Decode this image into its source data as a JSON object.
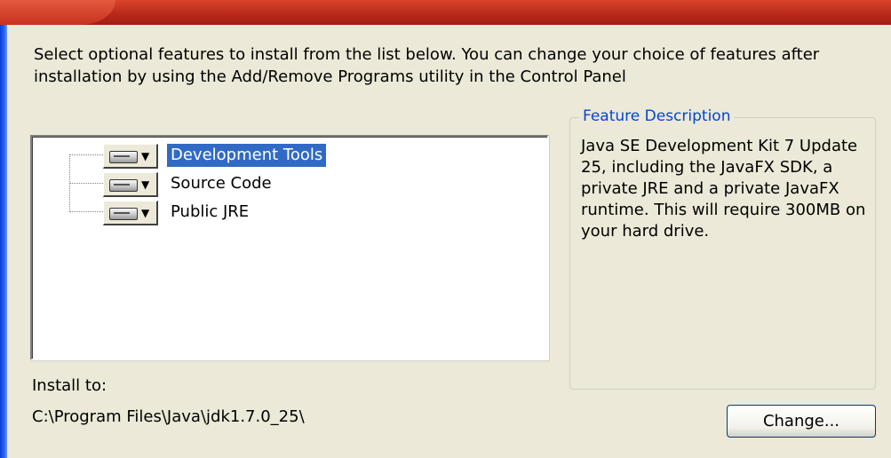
{
  "intro_text": "Select optional features to install from the list below.  You can change your choice of features after installation by using the Add/Remove Programs utility in the Control Panel",
  "features": [
    {
      "label": "Development Tools",
      "selected": true,
      "icon": "hard-drive-icon"
    },
    {
      "label": "Source Code",
      "selected": false,
      "icon": "hard-drive-icon"
    },
    {
      "label": "Public JRE",
      "selected": false,
      "icon": "hard-drive-icon"
    }
  ],
  "feature_description": {
    "legend": "Feature Description",
    "text": "Java SE Development Kit 7 Update 25, including the JavaFX SDK, a private JRE and a private JavaFX runtime.  This will require 300MB on your hard drive."
  },
  "install": {
    "label": "Install to:",
    "path": "C:\\Program Files\\Java\\jdk1.7.0_25\\"
  },
  "change_button": "Change...",
  "colors": {
    "selection": "#316AC5",
    "legend": "#0046D5",
    "background": "#ECE9D8"
  }
}
